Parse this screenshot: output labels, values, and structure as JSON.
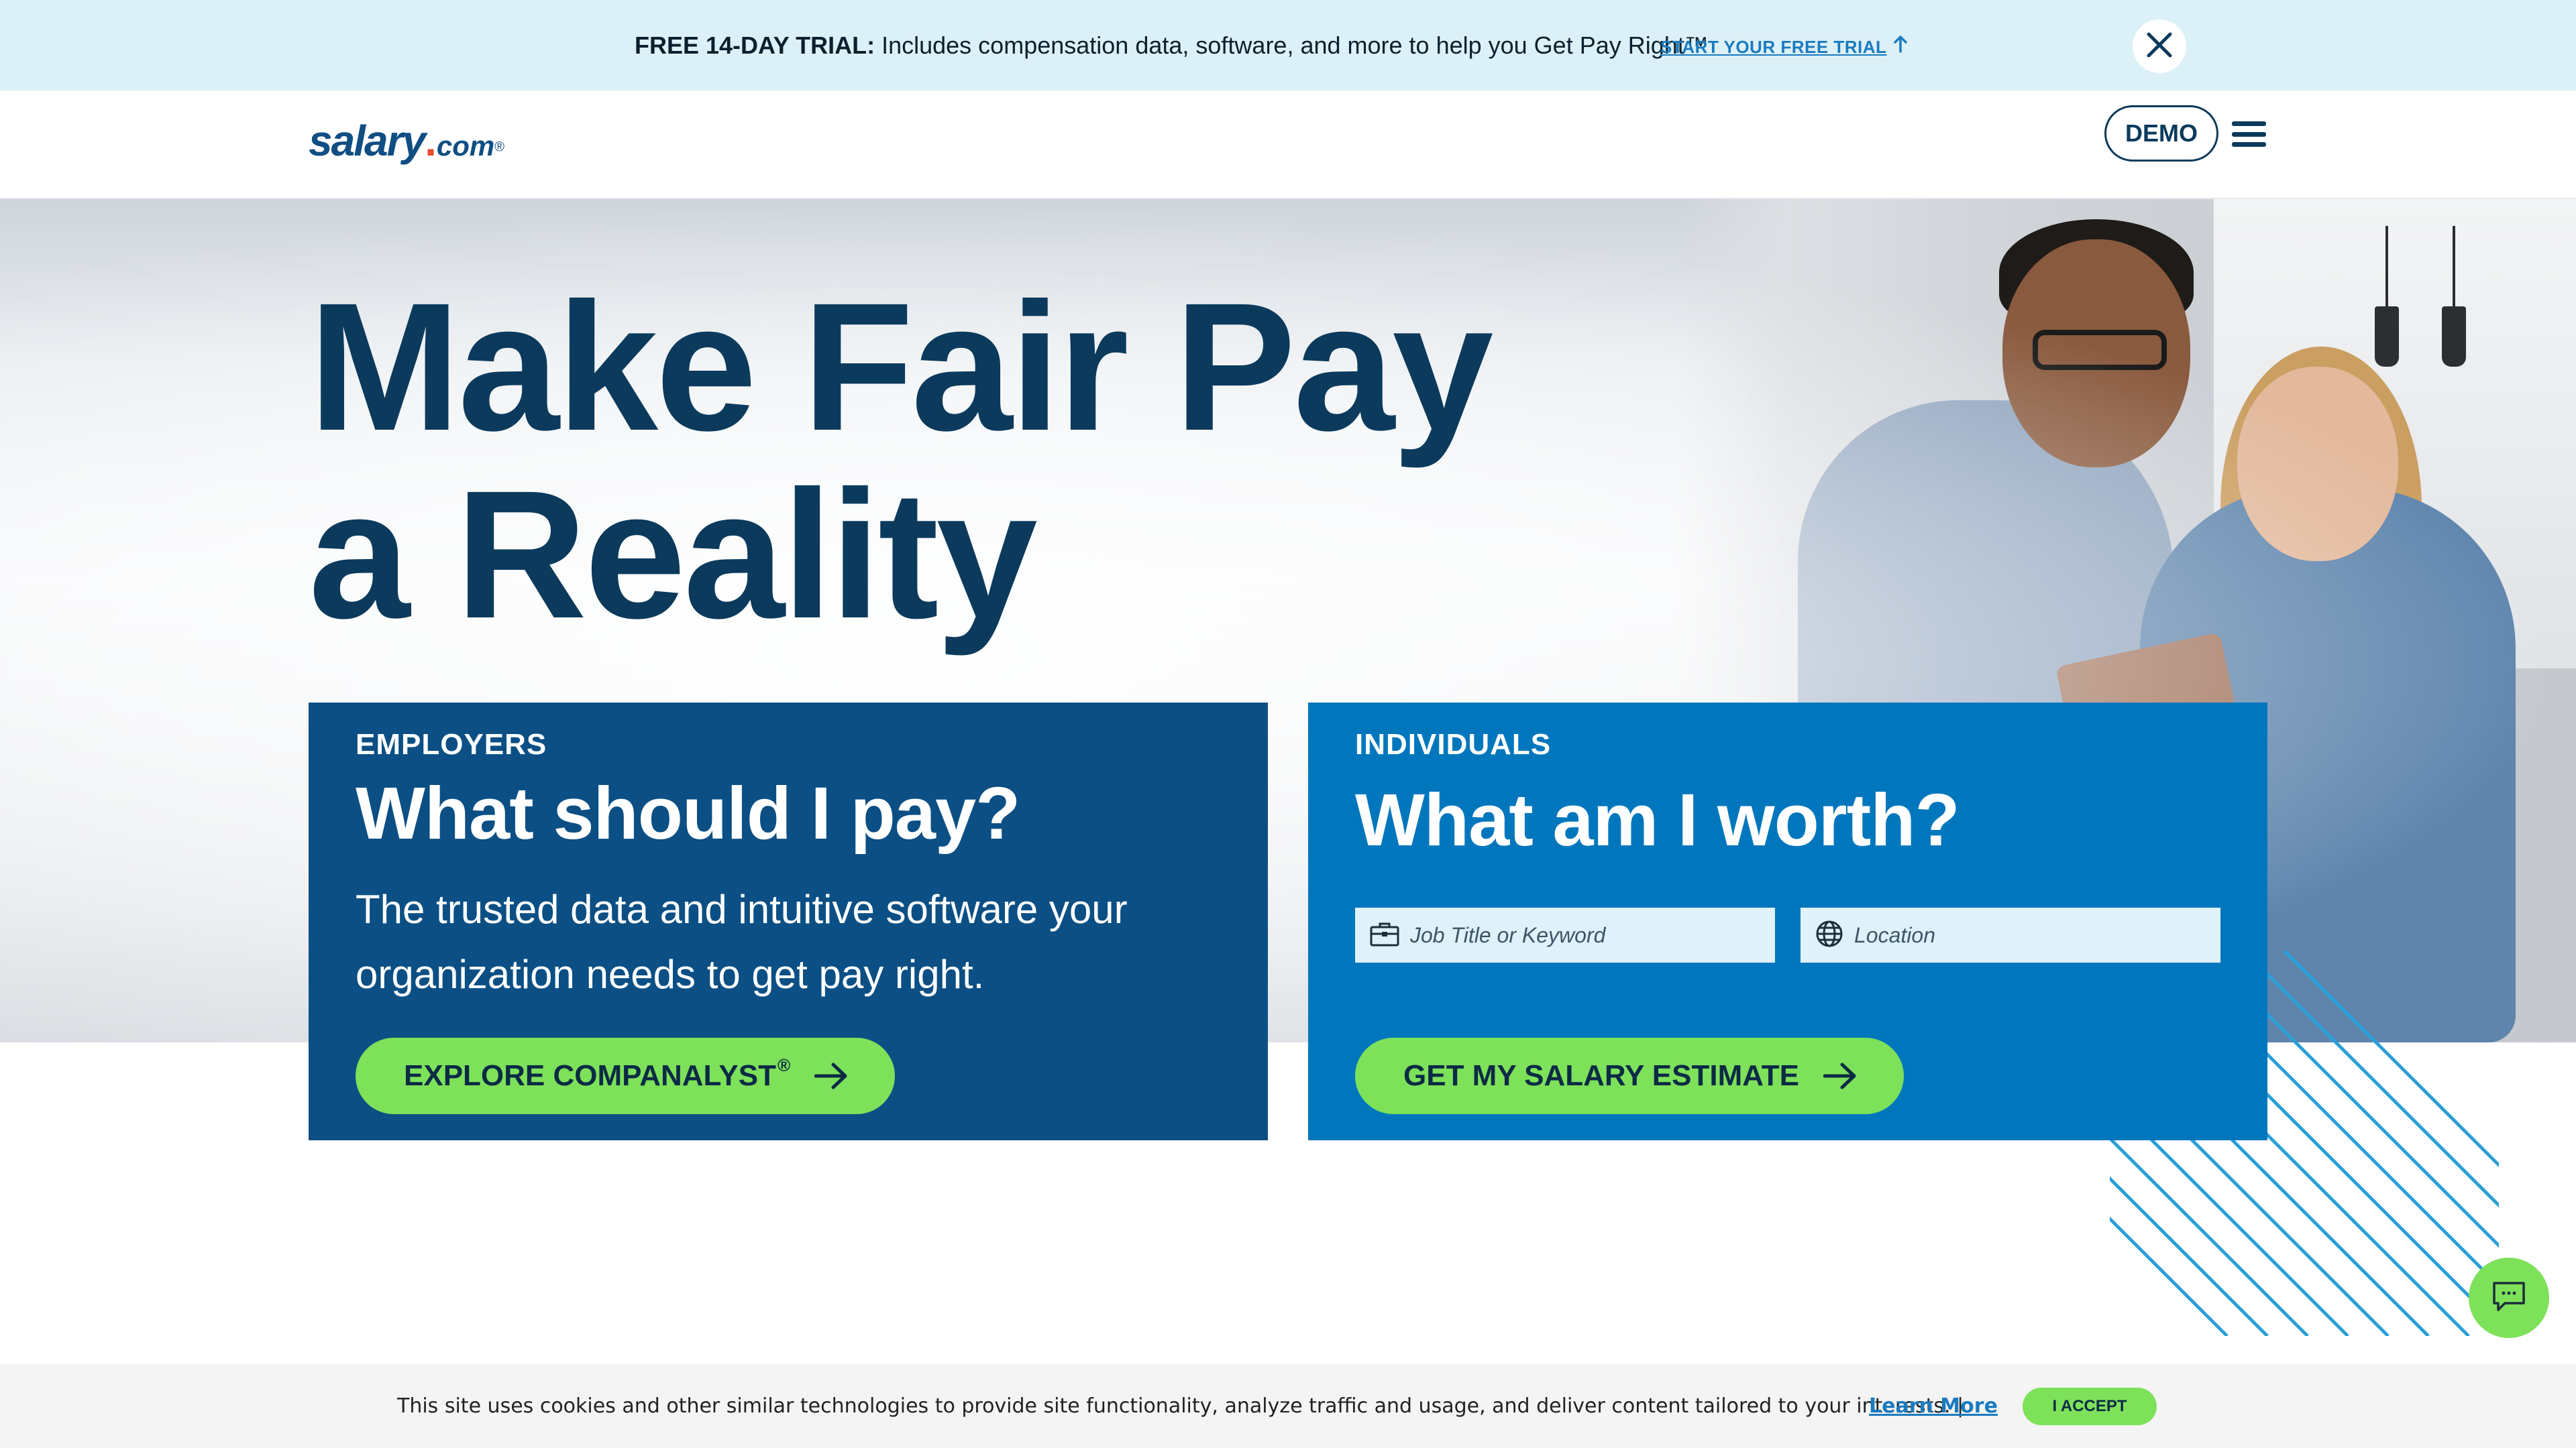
{
  "promo": {
    "bold": "FREE 14-DAY TRIAL:",
    "text": "Includes compensation data, software, and more to help you Get Pay Right™",
    "link": "START YOUR FREE TRIAL",
    "link_icon": "arrow-up-icon",
    "close_icon": "close-icon"
  },
  "header": {
    "logo_main": "salary",
    "logo_dot": ".",
    "logo_com": "com",
    "logo_reg": "®",
    "demo_label": "DEMO",
    "menu_icon": "hamburger-menu-icon"
  },
  "hero": {
    "title_line1": "Make Fair Pay",
    "title_line2": "a Reality"
  },
  "employers": {
    "eyebrow": "EMPLOYERS",
    "title": "What should I pay?",
    "desc": "The trusted data and intuitive software your organization needs to get pay right.",
    "cta_label": "EXPLORE COMPANALYST",
    "cta_reg": "®"
  },
  "individuals": {
    "eyebrow": "INDIVIDUALS",
    "title": "What am I worth?",
    "job_placeholder": "Job Title or Keyword",
    "job_icon": "briefcase-icon",
    "location_placeholder": "Location",
    "location_icon": "globe-icon",
    "cta_label": "GET MY SALARY ESTIMATE"
  },
  "chat": {
    "icon": "chat-icon"
  },
  "cookie": {
    "text": "This site uses cookies and other similar technologies to provide site functionality, analyze traffic and usage, and deliver content tailored to your interests. |",
    "link": "Learn More",
    "accept_label": "I ACCEPT"
  },
  "colors": {
    "navy": "#0b3a5c",
    "employers_bg": "#0b4f84",
    "individuals_bg": "#0077bd",
    "cta_green": "#7ee15a",
    "promo_bg": "#dcf0f8",
    "stripe_blue": "#2a9fd8"
  }
}
